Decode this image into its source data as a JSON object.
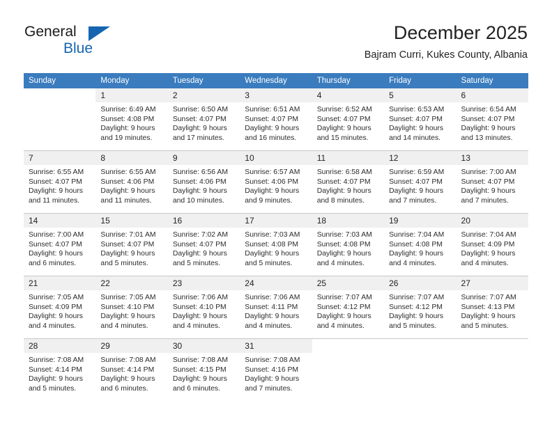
{
  "brand": {
    "name_part1": "General",
    "name_part2": "Blue",
    "triangle_color": "#1565b0",
    "blue_color": "#1565b0"
  },
  "header": {
    "title": "December 2025",
    "subtitle": "Bajram Curri, Kukes County, Albania"
  },
  "theme": {
    "header_row_bg": "#3a7cbe",
    "header_row_text": "#ffffff",
    "daynum_bg": "#f0f0f0",
    "cell_bg": "#ffffff",
    "separator": "#c8c8c8"
  },
  "weekday_headers": [
    "Sunday",
    "Monday",
    "Tuesday",
    "Wednesday",
    "Thursday",
    "Friday",
    "Saturday"
  ],
  "weeks": [
    {
      "days": [
        {
          "num": "",
          "sunrise": "",
          "sunset": "",
          "daylight_line1": "",
          "daylight_line2": ""
        },
        {
          "num": "1",
          "sunrise": "Sunrise: 6:49 AM",
          "sunset": "Sunset: 4:08 PM",
          "daylight_line1": "Daylight: 9 hours",
          "daylight_line2": "and 19 minutes."
        },
        {
          "num": "2",
          "sunrise": "Sunrise: 6:50 AM",
          "sunset": "Sunset: 4:07 PM",
          "daylight_line1": "Daylight: 9 hours",
          "daylight_line2": "and 17 minutes."
        },
        {
          "num": "3",
          "sunrise": "Sunrise: 6:51 AM",
          "sunset": "Sunset: 4:07 PM",
          "daylight_line1": "Daylight: 9 hours",
          "daylight_line2": "and 16 minutes."
        },
        {
          "num": "4",
          "sunrise": "Sunrise: 6:52 AM",
          "sunset": "Sunset: 4:07 PM",
          "daylight_line1": "Daylight: 9 hours",
          "daylight_line2": "and 15 minutes."
        },
        {
          "num": "5",
          "sunrise": "Sunrise: 6:53 AM",
          "sunset": "Sunset: 4:07 PM",
          "daylight_line1": "Daylight: 9 hours",
          "daylight_line2": "and 14 minutes."
        },
        {
          "num": "6",
          "sunrise": "Sunrise: 6:54 AM",
          "sunset": "Sunset: 4:07 PM",
          "daylight_line1": "Daylight: 9 hours",
          "daylight_line2": "and 13 minutes."
        }
      ]
    },
    {
      "days": [
        {
          "num": "7",
          "sunrise": "Sunrise: 6:55 AM",
          "sunset": "Sunset: 4:07 PM",
          "daylight_line1": "Daylight: 9 hours",
          "daylight_line2": "and 11 minutes."
        },
        {
          "num": "8",
          "sunrise": "Sunrise: 6:55 AM",
          "sunset": "Sunset: 4:06 PM",
          "daylight_line1": "Daylight: 9 hours",
          "daylight_line2": "and 11 minutes."
        },
        {
          "num": "9",
          "sunrise": "Sunrise: 6:56 AM",
          "sunset": "Sunset: 4:06 PM",
          "daylight_line1": "Daylight: 9 hours",
          "daylight_line2": "and 10 minutes."
        },
        {
          "num": "10",
          "sunrise": "Sunrise: 6:57 AM",
          "sunset": "Sunset: 4:06 PM",
          "daylight_line1": "Daylight: 9 hours",
          "daylight_line2": "and 9 minutes."
        },
        {
          "num": "11",
          "sunrise": "Sunrise: 6:58 AM",
          "sunset": "Sunset: 4:07 PM",
          "daylight_line1": "Daylight: 9 hours",
          "daylight_line2": "and 8 minutes."
        },
        {
          "num": "12",
          "sunrise": "Sunrise: 6:59 AM",
          "sunset": "Sunset: 4:07 PM",
          "daylight_line1": "Daylight: 9 hours",
          "daylight_line2": "and 7 minutes."
        },
        {
          "num": "13",
          "sunrise": "Sunrise: 7:00 AM",
          "sunset": "Sunset: 4:07 PM",
          "daylight_line1": "Daylight: 9 hours",
          "daylight_line2": "and 7 minutes."
        }
      ]
    },
    {
      "days": [
        {
          "num": "14",
          "sunrise": "Sunrise: 7:00 AM",
          "sunset": "Sunset: 4:07 PM",
          "daylight_line1": "Daylight: 9 hours",
          "daylight_line2": "and 6 minutes."
        },
        {
          "num": "15",
          "sunrise": "Sunrise: 7:01 AM",
          "sunset": "Sunset: 4:07 PM",
          "daylight_line1": "Daylight: 9 hours",
          "daylight_line2": "and 5 minutes."
        },
        {
          "num": "16",
          "sunrise": "Sunrise: 7:02 AM",
          "sunset": "Sunset: 4:07 PM",
          "daylight_line1": "Daylight: 9 hours",
          "daylight_line2": "and 5 minutes."
        },
        {
          "num": "17",
          "sunrise": "Sunrise: 7:03 AM",
          "sunset": "Sunset: 4:08 PM",
          "daylight_line1": "Daylight: 9 hours",
          "daylight_line2": "and 5 minutes."
        },
        {
          "num": "18",
          "sunrise": "Sunrise: 7:03 AM",
          "sunset": "Sunset: 4:08 PM",
          "daylight_line1": "Daylight: 9 hours",
          "daylight_line2": "and 4 minutes."
        },
        {
          "num": "19",
          "sunrise": "Sunrise: 7:04 AM",
          "sunset": "Sunset: 4:08 PM",
          "daylight_line1": "Daylight: 9 hours",
          "daylight_line2": "and 4 minutes."
        },
        {
          "num": "20",
          "sunrise": "Sunrise: 7:04 AM",
          "sunset": "Sunset: 4:09 PM",
          "daylight_line1": "Daylight: 9 hours",
          "daylight_line2": "and 4 minutes."
        }
      ]
    },
    {
      "days": [
        {
          "num": "21",
          "sunrise": "Sunrise: 7:05 AM",
          "sunset": "Sunset: 4:09 PM",
          "daylight_line1": "Daylight: 9 hours",
          "daylight_line2": "and 4 minutes."
        },
        {
          "num": "22",
          "sunrise": "Sunrise: 7:05 AM",
          "sunset": "Sunset: 4:10 PM",
          "daylight_line1": "Daylight: 9 hours",
          "daylight_line2": "and 4 minutes."
        },
        {
          "num": "23",
          "sunrise": "Sunrise: 7:06 AM",
          "sunset": "Sunset: 4:10 PM",
          "daylight_line1": "Daylight: 9 hours",
          "daylight_line2": "and 4 minutes."
        },
        {
          "num": "24",
          "sunrise": "Sunrise: 7:06 AM",
          "sunset": "Sunset: 4:11 PM",
          "daylight_line1": "Daylight: 9 hours",
          "daylight_line2": "and 4 minutes."
        },
        {
          "num": "25",
          "sunrise": "Sunrise: 7:07 AM",
          "sunset": "Sunset: 4:12 PM",
          "daylight_line1": "Daylight: 9 hours",
          "daylight_line2": "and 4 minutes."
        },
        {
          "num": "26",
          "sunrise": "Sunrise: 7:07 AM",
          "sunset": "Sunset: 4:12 PM",
          "daylight_line1": "Daylight: 9 hours",
          "daylight_line2": "and 5 minutes."
        },
        {
          "num": "27",
          "sunrise": "Sunrise: 7:07 AM",
          "sunset": "Sunset: 4:13 PM",
          "daylight_line1": "Daylight: 9 hours",
          "daylight_line2": "and 5 minutes."
        }
      ]
    },
    {
      "days": [
        {
          "num": "28",
          "sunrise": "Sunrise: 7:08 AM",
          "sunset": "Sunset: 4:14 PM",
          "daylight_line1": "Daylight: 9 hours",
          "daylight_line2": "and 5 minutes."
        },
        {
          "num": "29",
          "sunrise": "Sunrise: 7:08 AM",
          "sunset": "Sunset: 4:14 PM",
          "daylight_line1": "Daylight: 9 hours",
          "daylight_line2": "and 6 minutes."
        },
        {
          "num": "30",
          "sunrise": "Sunrise: 7:08 AM",
          "sunset": "Sunset: 4:15 PM",
          "daylight_line1": "Daylight: 9 hours",
          "daylight_line2": "and 6 minutes."
        },
        {
          "num": "31",
          "sunrise": "Sunrise: 7:08 AM",
          "sunset": "Sunset: 4:16 PM",
          "daylight_line1": "Daylight: 9 hours",
          "daylight_line2": "and 7 minutes."
        },
        {
          "num": "",
          "sunrise": "",
          "sunset": "",
          "daylight_line1": "",
          "daylight_line2": ""
        },
        {
          "num": "",
          "sunrise": "",
          "sunset": "",
          "daylight_line1": "",
          "daylight_line2": ""
        },
        {
          "num": "",
          "sunrise": "",
          "sunset": "",
          "daylight_line1": "",
          "daylight_line2": ""
        }
      ]
    }
  ]
}
